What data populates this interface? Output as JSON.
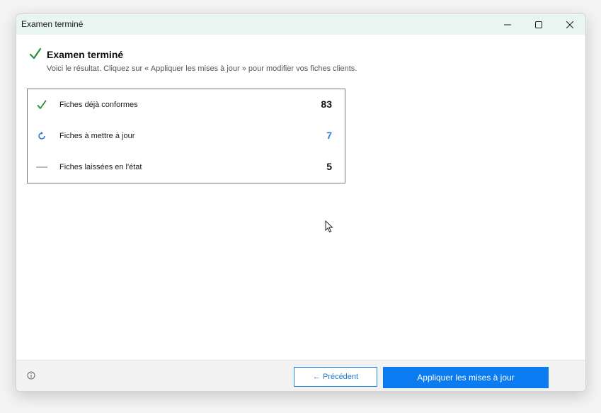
{
  "window": {
    "title": "Examen terminé"
  },
  "header": {
    "title": "Examen terminé",
    "subtitle": "Voici le résultat. Cliquez sur « Appliquer les mises à jour » pour modifier vos fiches clients."
  },
  "results": [
    {
      "icon": "check-icon",
      "label": "Fiches déjà conformes",
      "count": "83"
    },
    {
      "icon": "refresh-icon",
      "label": "Fiches à mettre à jour",
      "count": "7"
    },
    {
      "icon": "dash-icon",
      "label": "Fiches laissées en l'état",
      "count": "5"
    }
  ],
  "footer": {
    "prev_label": "← Précédent",
    "apply_label": "Appliquer les mises à jour"
  },
  "colors": {
    "accent": "#0a7bf0",
    "success": "#2e8b3a",
    "update": "#2b7bd6",
    "titlebar": "#e8f5f1"
  }
}
